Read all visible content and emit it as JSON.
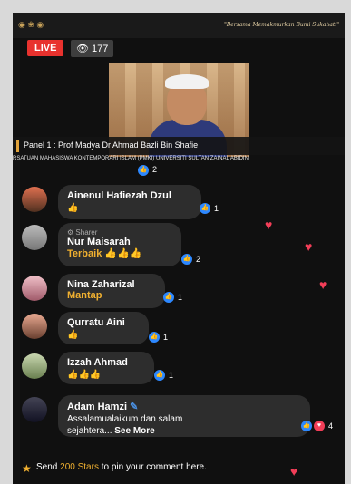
{
  "stream": {
    "live_label": "LIVE",
    "viewer_count": "177",
    "banner_text": "\"Bersama Memakmurkan Bumi Sukahati\"",
    "panel_text": "Panel 1 : Prof Madya Dr Ahmad Bazli Bin Shafie",
    "org_text": "RSATUAN MAHASISWA KONTEMPORARI ISLAM (PMKI) UNIVERSITI SULTAN ZAINAL ABIDIN"
  },
  "comments": [
    {
      "name": "Ainenul Hafiezah Dzul",
      "text": "👍",
      "reactions": "1"
    },
    {
      "name": "Nur Maisarah",
      "sharer": "Sharer",
      "text": "Terbaik 👍👍👍",
      "reactions": "2"
    },
    {
      "name": "Nina Zaharizal",
      "text": "Mantap",
      "reactions": "1"
    },
    {
      "name": "Qurratu Aini",
      "text": "👍",
      "reactions": "1"
    },
    {
      "name": "Izzah Ahmad",
      "text": "👍👍👍",
      "reactions": "1"
    },
    {
      "name": "Adam Hamzi",
      "text": "Assalamualaikum dan salam",
      "text2": "sejahtera... ",
      "see_more": "See More",
      "reactions": "4"
    }
  ],
  "top_partial_count": "2",
  "footer": {
    "pre": "Send ",
    "stars": "200 Stars",
    "post": " to pin your comment here."
  },
  "colors": {
    "live": "#e8322e",
    "like": "#2d88ff",
    "heart": "#f33e58",
    "accent": "#f0b030"
  }
}
